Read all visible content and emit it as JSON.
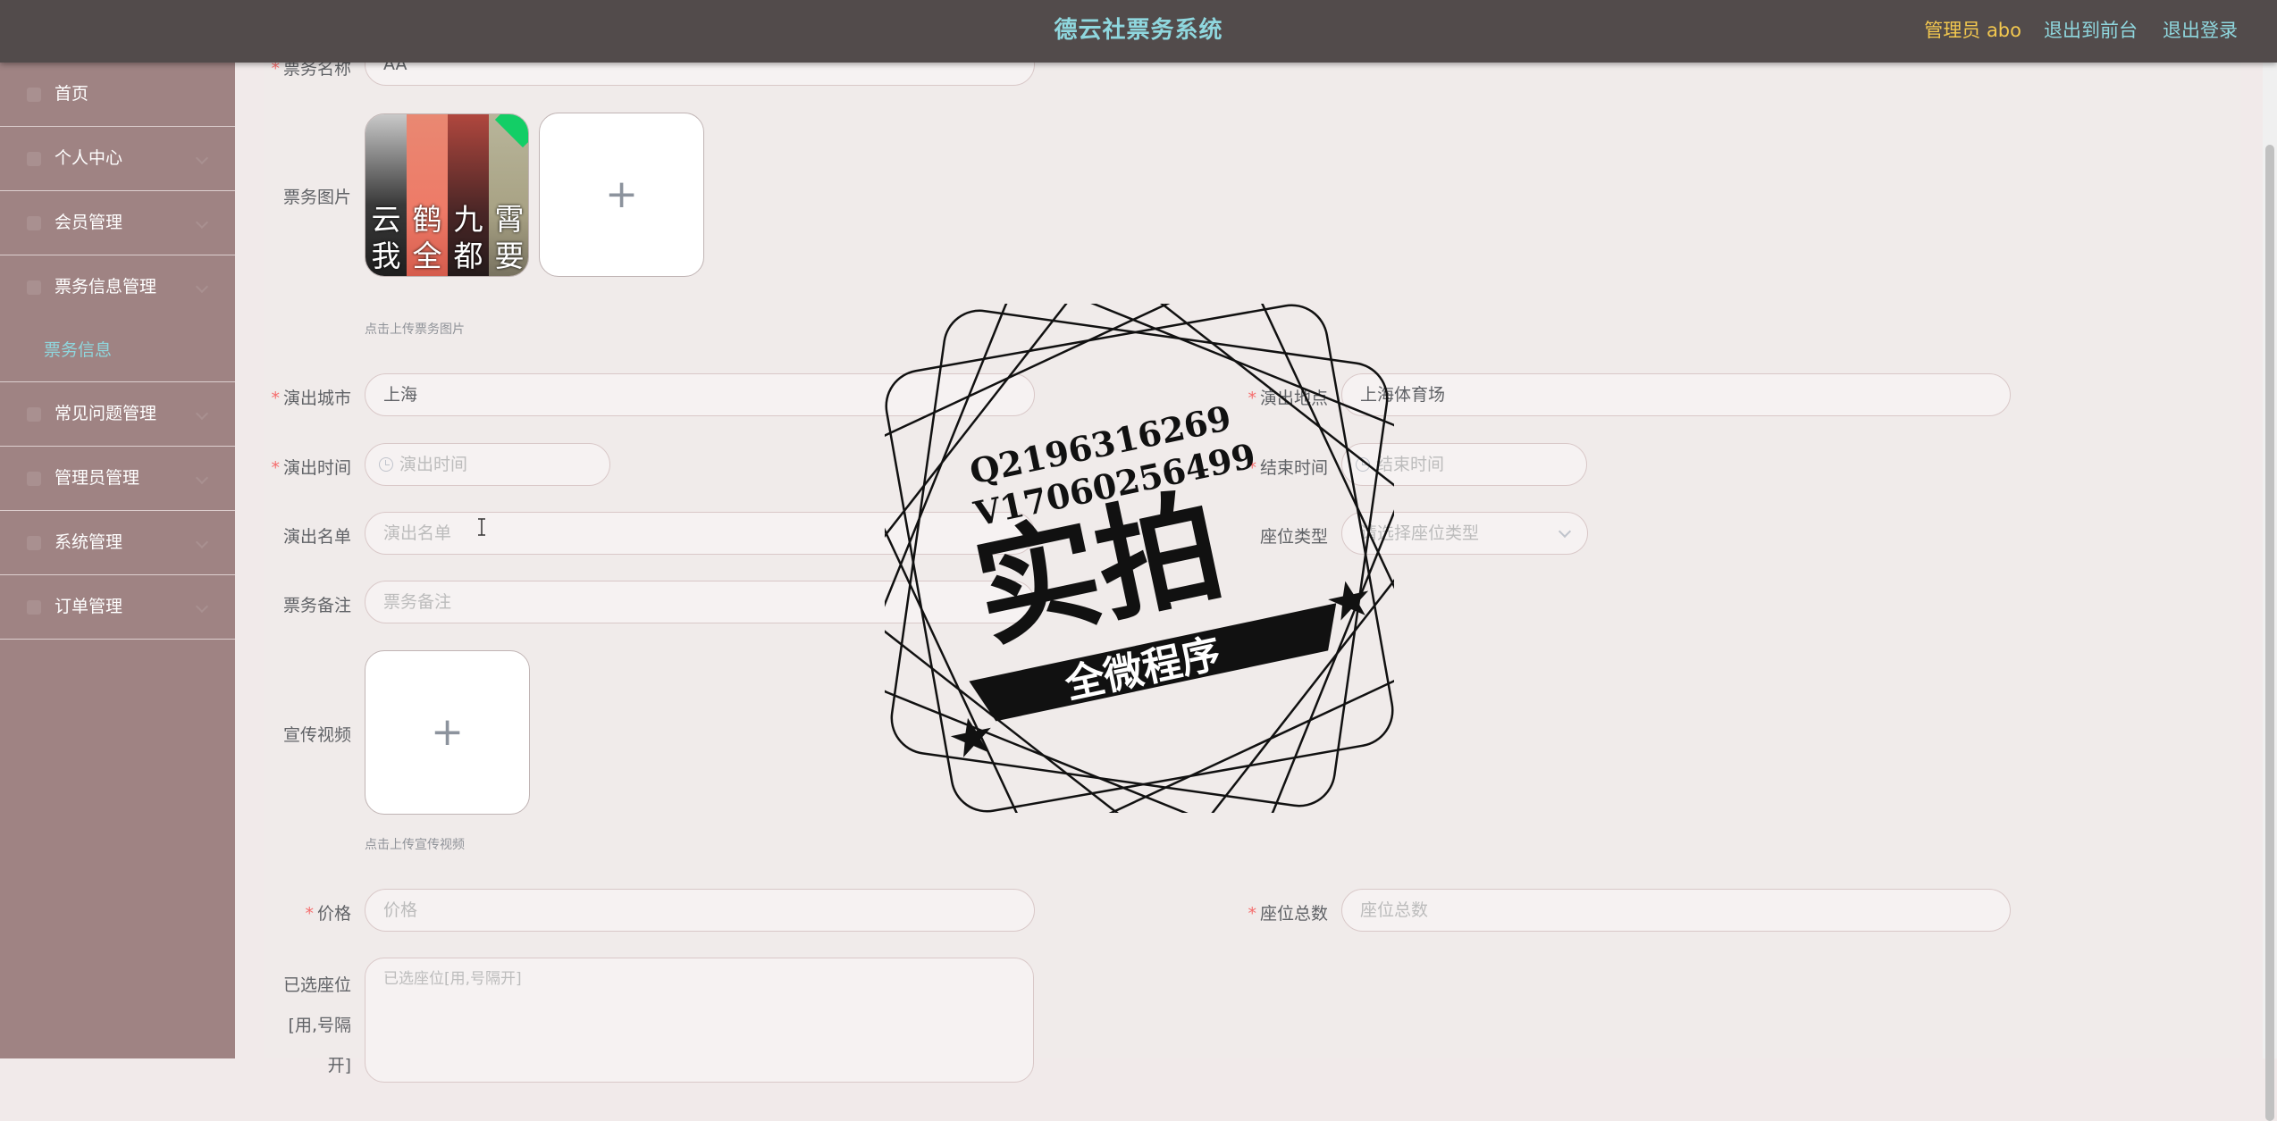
{
  "header": {
    "title": "德云社票务系统",
    "admin_label": "管理员 abo",
    "back_to_front": "退出到前台",
    "logout": "退出登录"
  },
  "sidebar": {
    "items": [
      {
        "label": "首页",
        "icon": "home-icon"
      },
      {
        "label": "个人中心",
        "icon": "user-icon"
      },
      {
        "label": "会员管理",
        "icon": "members-icon"
      },
      {
        "label": "票务信息管理",
        "icon": "ticket-icon"
      },
      {
        "label": "常见问题管理",
        "icon": "faq-icon"
      },
      {
        "label": "管理员管理",
        "icon": "admin-icon"
      },
      {
        "label": "系统管理",
        "icon": "system-icon"
      },
      {
        "label": "订单管理",
        "icon": "order-icon"
      }
    ],
    "sub_active": "票务信息"
  },
  "form": {
    "ticket_name": {
      "label": "票务名称",
      "value": "AA"
    },
    "ticket_image": {
      "label": "票务图片",
      "hint": "点击上传票务图片",
      "thumb_chars": [
        "云我",
        "鹤全",
        "九都",
        "霄要"
      ]
    },
    "city": {
      "label": "演出城市",
      "value": "上海"
    },
    "venue": {
      "label": "演出地点",
      "value": "上海体育场"
    },
    "start_time": {
      "label": "演出时间",
      "placeholder": "演出时间"
    },
    "end_time": {
      "label": "结束时间",
      "placeholder": "结束时间"
    },
    "cast": {
      "label": "演出名单",
      "placeholder": "演出名单"
    },
    "seat_type": {
      "label": "座位类型",
      "placeholder": "请选择座位类型"
    },
    "note": {
      "label": "票务备注",
      "placeholder": "票务备注"
    },
    "video": {
      "label": "宣传视频",
      "hint": "点击上传宣传视频"
    },
    "price": {
      "label": "价格",
      "placeholder": "价格"
    },
    "total_seats": {
      "label": "座位总数",
      "placeholder": "座位总数"
    },
    "selected_seats": {
      "label_lines": [
        "已选座位",
        "[用,号隔",
        "开]"
      ],
      "placeholder": "已选座位[用,号隔开]"
    }
  },
  "watermark": {
    "line1": "Q2196316269",
    "line2": "V17060256499",
    "main": "实拍",
    "ribbon": "全微程序"
  }
}
